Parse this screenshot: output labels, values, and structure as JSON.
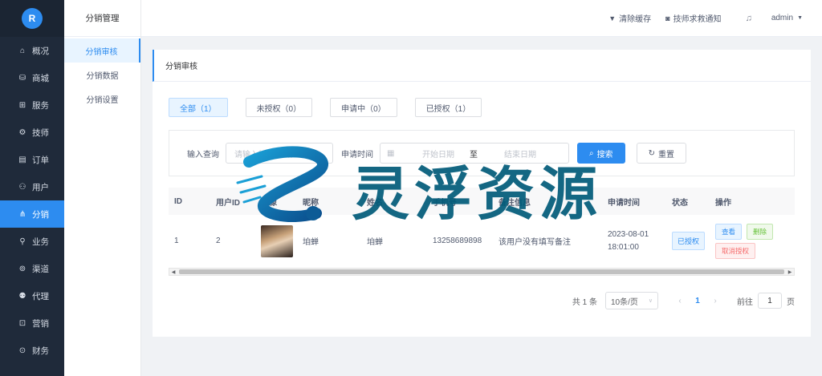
{
  "sidebar": {
    "logo_letter": "R",
    "items": [
      {
        "label": "概况",
        "icon": "home-icon",
        "glyph": "⌂",
        "active": false
      },
      {
        "label": "商城",
        "icon": "bag-icon",
        "glyph": "⛁",
        "active": false
      },
      {
        "label": "服务",
        "icon": "service-icon",
        "glyph": "⊞",
        "active": false
      },
      {
        "label": "技师",
        "icon": "technician-icon",
        "glyph": "⚙",
        "active": false
      },
      {
        "label": "订单",
        "icon": "order-icon",
        "glyph": "▤",
        "active": false
      },
      {
        "label": "用户",
        "icon": "users-icon",
        "glyph": "⚇",
        "active": false
      },
      {
        "label": "分销",
        "icon": "distribution-icon",
        "glyph": "⋔",
        "active": true
      },
      {
        "label": "业务",
        "icon": "business-icon",
        "glyph": "⚲",
        "active": false
      },
      {
        "label": "渠道",
        "icon": "channel-icon",
        "glyph": "⊚",
        "active": false
      },
      {
        "label": "代理",
        "icon": "agent-icon",
        "glyph": "⚉",
        "active": false
      },
      {
        "label": "营销",
        "icon": "marketing-icon",
        "glyph": "⊡",
        "active": false
      },
      {
        "label": "财务",
        "icon": "finance-icon",
        "glyph": "⊙",
        "active": false
      }
    ]
  },
  "submenu": {
    "title": "分销管理",
    "items": [
      {
        "label": "分销审核",
        "active": true
      },
      {
        "label": "分销数据",
        "active": false
      },
      {
        "label": "分销设置",
        "active": false
      }
    ]
  },
  "header": {
    "clear_cache": "清除缓存",
    "tech_notify": "技师求救通知",
    "user": "admin"
  },
  "card": {
    "title": "分销审核"
  },
  "tabs": [
    {
      "label": "全部（1）",
      "active": true
    },
    {
      "label": "未授权（0）",
      "active": false
    },
    {
      "label": "申请中（0）",
      "active": false
    },
    {
      "label": "已授权（1）",
      "active": false
    }
  ],
  "filter": {
    "query_label": "输入查询",
    "query_placeholder": "请输入姓名/电话",
    "time_label": "申请时间",
    "start_placeholder": "开始日期",
    "range_sep": "至",
    "end_placeholder": "结束日期",
    "search_btn": "搜索",
    "reset_btn": "重置"
  },
  "table": {
    "headers": [
      "ID",
      "用户ID",
      "头像",
      "昵称",
      "姓名",
      "手机号",
      "备注信息",
      "申请时间",
      "状态",
      "操作"
    ],
    "rows": [
      {
        "id": "1",
        "user_id": "2",
        "nickname": "垍蝉",
        "name": "垍蝉",
        "phone": "13258689898",
        "remark": "该用户没有填写备注",
        "date": "2023-08-01",
        "time": "18:01:00",
        "status": "已授权",
        "actions": {
          "view": "查看",
          "delete": "删除",
          "revoke": "取消授权"
        }
      }
    ]
  },
  "pagination": {
    "total": "共 1 条",
    "page_size": "10条/页",
    "current": "1",
    "goto_prefix": "前往",
    "goto_value": "1",
    "goto_suffix": "页"
  },
  "watermark": {
    "text": "灵浮资源"
  },
  "colors": {
    "sidebar_bg": "#1f2a3a",
    "accent": "#2d8cf0",
    "success": "#67c23a",
    "danger": "#f56c6c"
  }
}
